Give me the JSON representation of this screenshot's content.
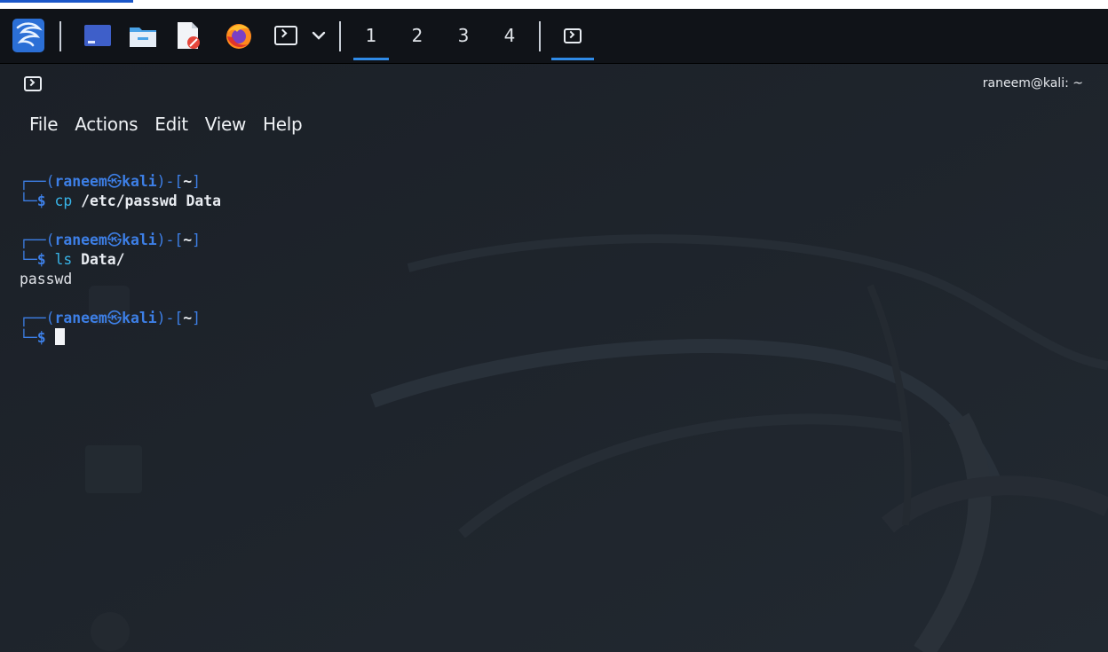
{
  "colors": {
    "prompt_blue": "#3d7fe6",
    "command_cyan": "#38b4e8",
    "taskbar_bg": "#101318",
    "terminal_bg": "#1c2128",
    "active_indicator": "#2f8ae6"
  },
  "taskbar": {
    "launcher_icon": "kali-dragon-icon",
    "apps": [
      {
        "name": "workspace-desktop-icon"
      },
      {
        "name": "file-manager-icon"
      },
      {
        "name": "text-editor-icon"
      },
      {
        "name": "firefox-icon"
      },
      {
        "name": "terminal-icon"
      },
      {
        "name": "chevron-down-icon"
      }
    ],
    "workspaces": [
      "1",
      "2",
      "3",
      "4"
    ],
    "active_workspace": "1",
    "open_window_icon": "terminal-icon"
  },
  "window": {
    "icon": "terminal-icon",
    "title": "raneem@kali: ~",
    "menu": [
      "File",
      "Actions",
      "Edit",
      "View",
      "Help"
    ]
  },
  "terminal": {
    "user": "raneem",
    "host": "kali",
    "dir": "~",
    "blocks": [
      {
        "cmd": "cp",
        "args": " /etc/passwd Data",
        "output": ""
      },
      {
        "cmd": "ls",
        "args": " Data/",
        "output": "passwd"
      },
      {
        "cmd": "",
        "args": "",
        "output": ""
      }
    ]
  }
}
